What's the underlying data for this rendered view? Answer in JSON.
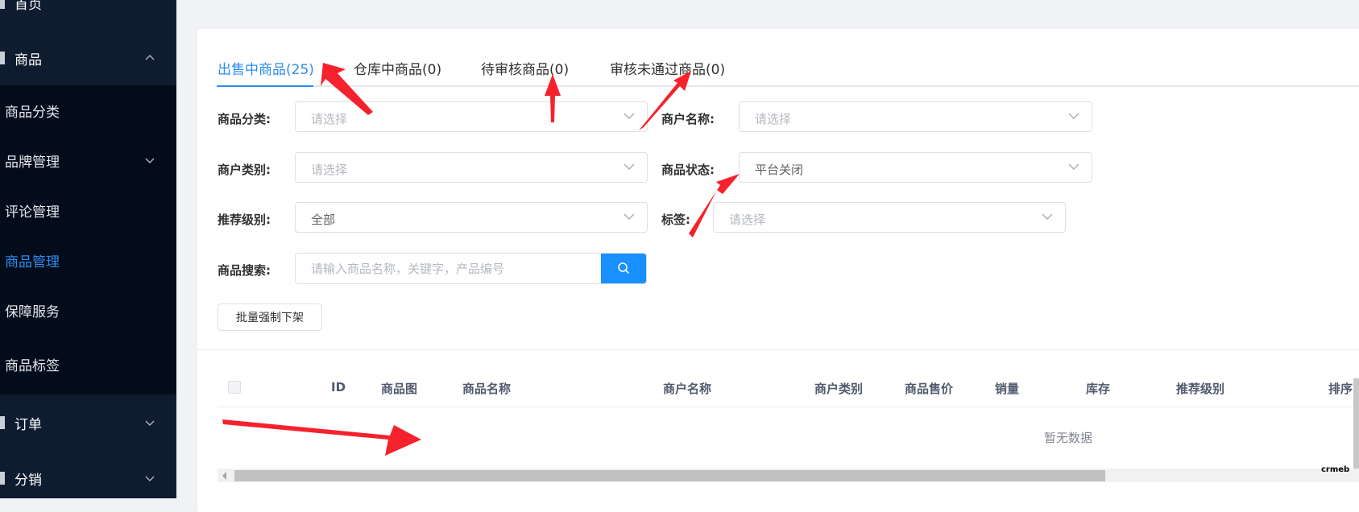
{
  "sidebar": {
    "items": [
      {
        "label": "首页",
        "type": "top",
        "chevron": ""
      },
      {
        "label": "商品",
        "type": "top",
        "chevron": "up"
      },
      {
        "label": "商品分类",
        "type": "sub",
        "chevron": ""
      },
      {
        "label": "品牌管理",
        "type": "sub",
        "chevron": "down"
      },
      {
        "label": "评论管理",
        "type": "sub",
        "chevron": ""
      },
      {
        "label": "商品管理",
        "type": "sub",
        "chevron": "",
        "active": true
      },
      {
        "label": "保障服务",
        "type": "sub",
        "chevron": ""
      },
      {
        "label": "商品标签",
        "type": "sub",
        "chevron": ""
      },
      {
        "label": "订单",
        "type": "top",
        "chevron": "down"
      },
      {
        "label": "分销",
        "type": "top",
        "chevron": "down"
      }
    ]
  },
  "tabs": [
    {
      "label": "出售中商品(25)",
      "active": true
    },
    {
      "label": "仓库中商品(0)"
    },
    {
      "label": "待审核商品(0)"
    },
    {
      "label": "审核未通过商品(0)"
    }
  ],
  "filters": {
    "category_label": "商品分类:",
    "category_value": "请选择",
    "merchant_name_label": "商户名称:",
    "merchant_name_value": "请选择",
    "merchant_type_label": "商户类别:",
    "merchant_type_value": "请选择",
    "status_label": "商品状态:",
    "status_value": "平台关闭",
    "recommend_label": "推荐级别:",
    "recommend_value": "全部",
    "tag_label": "标签:",
    "tag_value": "请选择",
    "search_label": "商品搜索:",
    "search_placeholder": "请输入商品名称，关键字，产品编号"
  },
  "actions": {
    "batch_offline_label": "批量强制下架"
  },
  "table": {
    "columns": [
      "ID",
      "商品图",
      "商品名称",
      "商户名称",
      "商户类别",
      "商品售价",
      "销量",
      "库存",
      "推荐级别",
      "排序"
    ],
    "empty_text": "暂无数据"
  },
  "watermark": "crmeb",
  "colors": {
    "accent": "#2d8cf0",
    "sidebar_bg": "#0f1b2f",
    "submenu_bg": "#030c1b",
    "search_button": "#1890ff",
    "annotation_arrow": "#f5222d"
  }
}
